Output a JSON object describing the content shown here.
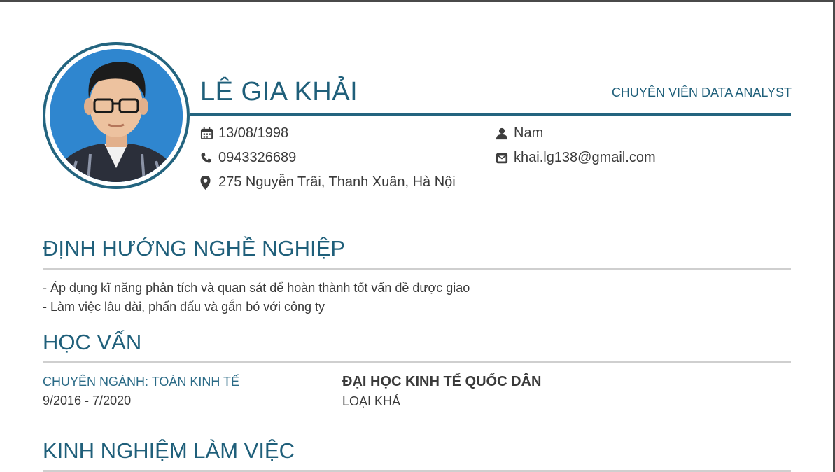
{
  "profile": {
    "name": "LÊ GIA KHẢI",
    "position": "CHUYÊN VIÊN DATA ANALYST",
    "birthday": "13/08/1998",
    "phone": "0943326689",
    "address": "275 Nguyễn Trãi, Thanh Xuân, Hà Nội",
    "gender": "Nam",
    "email": "khai.lg138@gmail.com",
    "icons": {
      "birthday": "calendar-icon",
      "phone": "phone-icon",
      "address": "map-marker-icon",
      "gender": "user-icon",
      "email": "envelope-icon"
    }
  },
  "sections": {
    "objective": {
      "title": "ĐỊNH HƯỚNG NGHỀ NGHIỆP",
      "lines": [
        "- Áp dụng kĩ năng phân tích và quan sát để hoàn thành tốt vấn đề được giao",
        "- Làm việc lâu dài, phấn đấu và gắn bó với công ty"
      ]
    },
    "education": {
      "title": "HỌC VẤN",
      "major": "CHUYÊN NGÀNH: TOÁN KINH TẾ",
      "time": "9/2016 - 7/2020",
      "school": "ĐẠI HỌC KINH TẾ QUỐC DÂN",
      "rank": "LOẠI KHÁ"
    },
    "experience": {
      "title": "KINH NGHIỆM LÀM VIỆC"
    }
  },
  "colors": {
    "accent": "#1f5f7a",
    "rule": "#23647f",
    "divider": "#cfcfcf",
    "text": "#3a3a3a"
  }
}
